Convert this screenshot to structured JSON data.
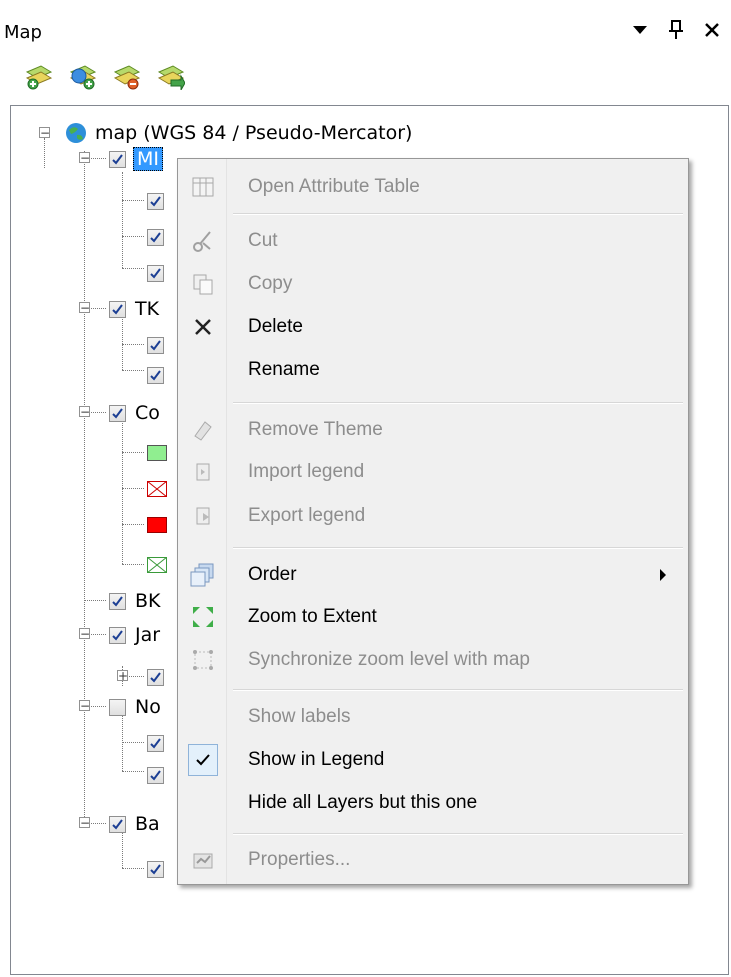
{
  "panel": {
    "title": "Map",
    "buttons": {
      "dropdown": "▾",
      "pin": "ᵼ",
      "close": "✕"
    },
    "toolbar": [
      "add-layer-icon",
      "add-web-layer-icon",
      "remove-layer-icon",
      "arrange-layers-icon"
    ]
  },
  "tree": {
    "root_label": "map (WGS 84 / Pseudo-Mercator)",
    "visible_labels": {
      "mi": "MI",
      "tk": "TK",
      "co": "Co",
      "bk": "BK",
      "ja": "Jar",
      "no": "No",
      "ba": "Ba"
    }
  },
  "menu": {
    "items": [
      {
        "label": "Open Attribute Table",
        "icon": "table-icon",
        "enabled": false
      },
      {
        "label": "Cut",
        "icon": "scissors-icon",
        "enabled": false
      },
      {
        "label": "Copy",
        "icon": "copy-icon",
        "enabled": false
      },
      {
        "label": "Delete",
        "icon": "delete-icon",
        "enabled": true
      },
      {
        "label": "Rename",
        "icon": "",
        "enabled": true
      },
      {
        "label": "Remove Theme",
        "icon": "eraser-icon",
        "enabled": false
      },
      {
        "label": "Import legend",
        "icon": "import-icon",
        "enabled": false
      },
      {
        "label": "Export legend",
        "icon": "export-icon",
        "enabled": false
      },
      {
        "label": "Order",
        "icon": "order-icon",
        "enabled": true
      },
      {
        "label": "Zoom to Extent",
        "icon": "zoom-extent-icon",
        "enabled": true
      },
      {
        "label": "Synchronize zoom level with map",
        "icon": "sync-zoom-icon",
        "enabled": false
      },
      {
        "label": "Show labels",
        "icon": "",
        "enabled": false
      },
      {
        "label": "Show in Legend",
        "icon": "check-icon",
        "enabled": true,
        "checked": true
      },
      {
        "label": "Hide all Layers but this one",
        "icon": "",
        "enabled": true
      },
      {
        "label": "Properties...",
        "icon": "properties-icon",
        "enabled": false
      }
    ]
  },
  "colors": {
    "selection": "#3399ff",
    "swatch_green": "#90ee90",
    "swatch_red": "#ff0000"
  }
}
